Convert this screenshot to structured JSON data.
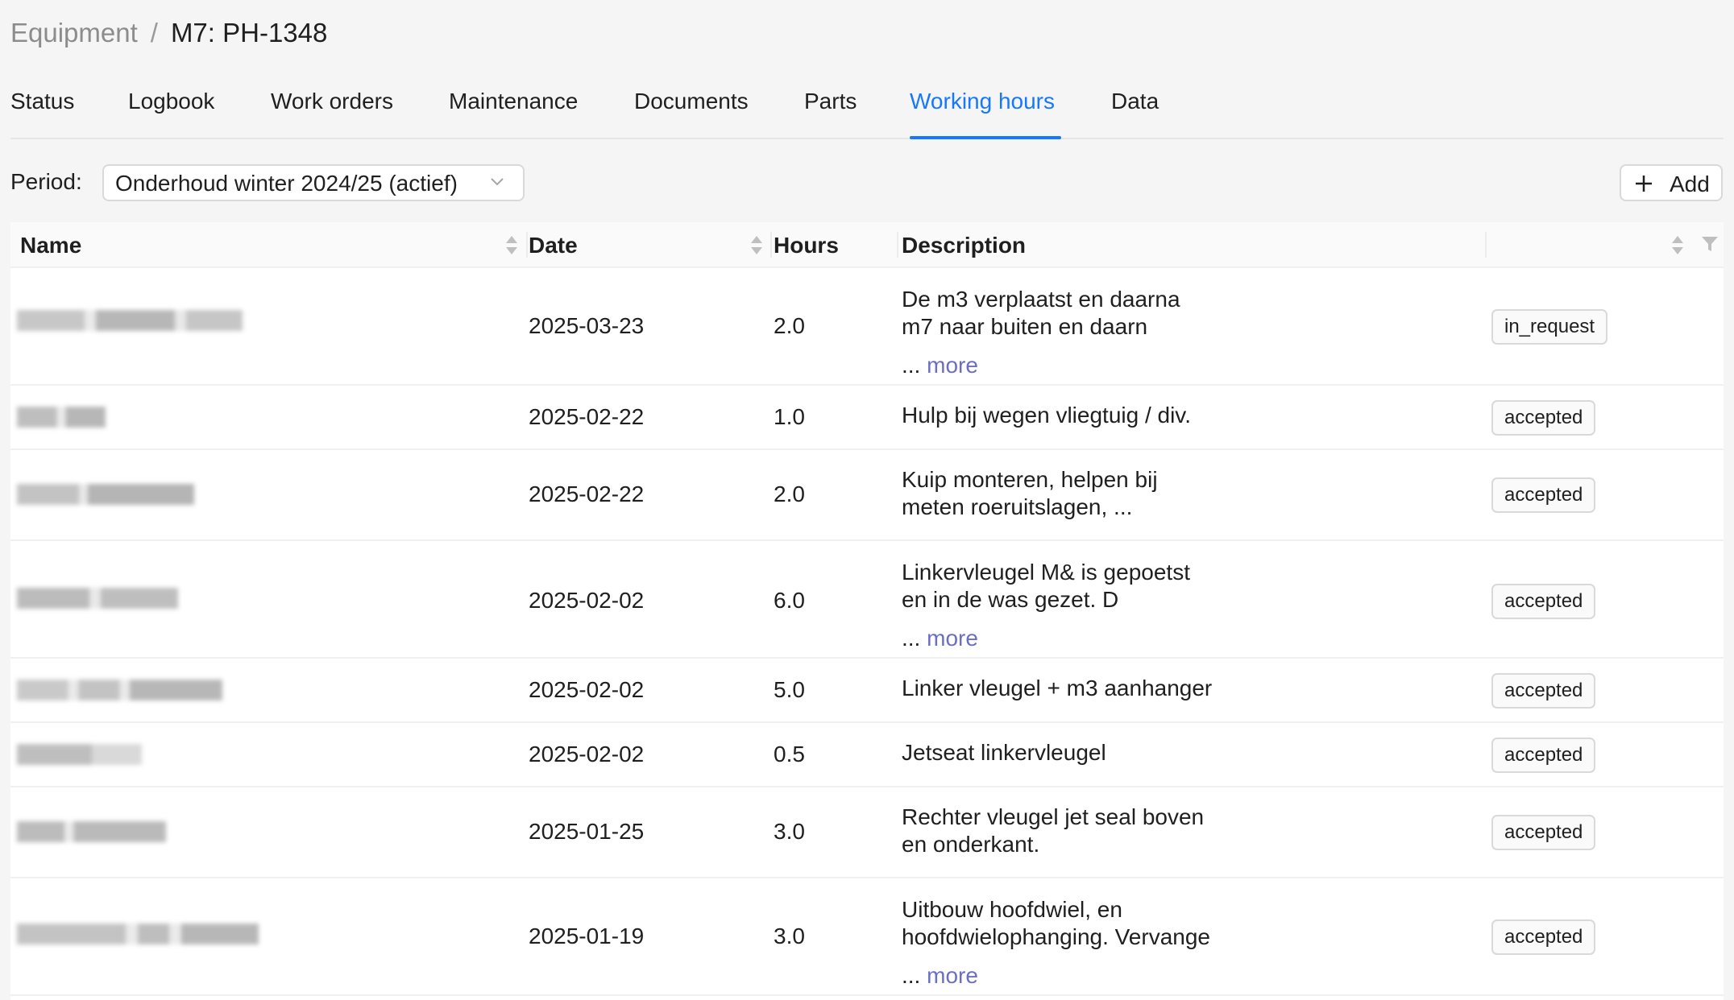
{
  "breadcrumb": {
    "parent": "Equipment",
    "separator": "/",
    "current": "M7: PH-1348"
  },
  "tabs": [
    {
      "label": "Status"
    },
    {
      "label": "Logbook"
    },
    {
      "label": "Work orders"
    },
    {
      "label": "Maintenance"
    },
    {
      "label": "Documents"
    },
    {
      "label": "Parts"
    },
    {
      "label": "Working hours",
      "active": true
    },
    {
      "label": "Data"
    }
  ],
  "toolbar": {
    "period_label": "Period:",
    "period_value": "Onderhoud winter 2024/25 (actief)",
    "add_label": "Add"
  },
  "table": {
    "columns": {
      "name": "Name",
      "date": "Date",
      "hours": "Hours",
      "description": "Description"
    },
    "rows": [
      {
        "date": "2025-03-23",
        "hours": "2.0",
        "desc": [
          "De m3 verplaatst en daarna",
          "m7 naar buiten en daarn"
        ],
        "ellipsis": "...",
        "more": "more",
        "status": "in_request"
      },
      {
        "date": "2025-02-22",
        "hours": "1.0",
        "desc": [
          "Hulp bij wegen vliegtuig / div."
        ],
        "status": "accepted"
      },
      {
        "date": "2025-02-22",
        "hours": "2.0",
        "desc": [
          "Kuip monteren, helpen bij",
          "meten roeruitslagen, ..."
        ],
        "status": "accepted"
      },
      {
        "date": "2025-02-02",
        "hours": "6.0",
        "desc": [
          "Linkervleugel M& is gepoetst",
          "en in de was gezet. D"
        ],
        "ellipsis": "...",
        "more": "more",
        "status": "accepted"
      },
      {
        "date": "2025-02-02",
        "hours": "5.0",
        "desc": [
          "Linker vleugel + m3 aanhanger"
        ],
        "status": "accepted"
      },
      {
        "date": "2025-02-02",
        "hours": "0.5",
        "desc": [
          "Jetseat linkervleugel"
        ],
        "status": "accepted"
      },
      {
        "date": "2025-01-25",
        "hours": "3.0",
        "desc": [
          "Rechter vleugel jet seal boven",
          "en onderkant."
        ],
        "status": "accepted"
      },
      {
        "date": "2025-01-19",
        "hours": "3.0",
        "desc": [
          "Uitbouw hoofdwiel, en",
          "hoofdwielophanging. Vervange"
        ],
        "ellipsis": "...",
        "more": "more",
        "status": "accepted"
      }
    ]
  },
  "colors": {
    "accent": "#1677ff",
    "more_link": "#6b6fc4",
    "name_blur": "#b5b5b5"
  },
  "icons": {
    "select_arrow": "chevron-down-icon",
    "add": "plus-icon",
    "sort": "sort-icon",
    "filter": "filter-icon"
  }
}
